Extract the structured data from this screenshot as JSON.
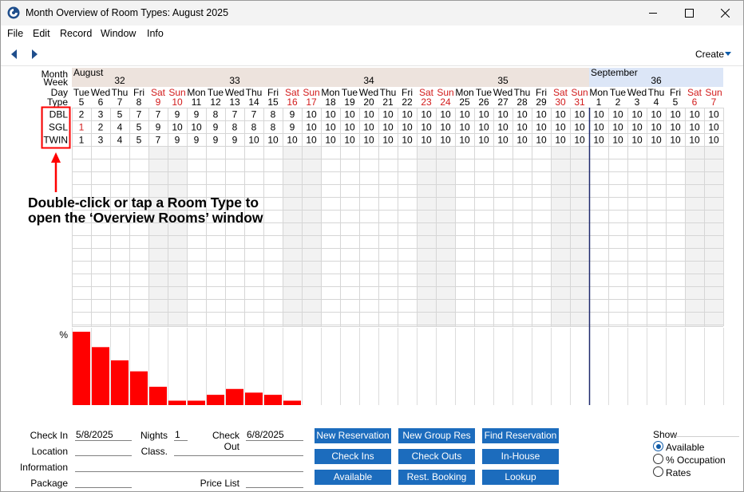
{
  "window": {
    "title": "Month Overview of Room Types: August 2025",
    "controls": {
      "minimize": "minimize",
      "maximize": "maximize",
      "close": "close"
    }
  },
  "menu": [
    "File",
    "Edit",
    "Record",
    "Window",
    "Info"
  ],
  "toolbar": {
    "create_label": "Create"
  },
  "grid": {
    "header_labels": {
      "month": "Month",
      "week": "Week",
      "day": "Day",
      "type": "Type"
    },
    "months": [
      {
        "name": "August",
        "bg": "#ede3dd"
      },
      {
        "name": "September",
        "bg": "#dce6f7"
      }
    ],
    "weeks": [
      {
        "label": "32",
        "start": 0,
        "span": 5
      },
      {
        "label": "33",
        "start": 5,
        "span": 7
      },
      {
        "label": "34",
        "start": 12,
        "span": 7
      },
      {
        "label": "35",
        "start": 19,
        "span": 7
      },
      {
        "label": "36",
        "start": 27,
        "span": 7
      }
    ],
    "days": [
      {
        "dow": "Tue",
        "date": "5",
        "weekend": false
      },
      {
        "dow": "Wed",
        "date": "6",
        "weekend": false
      },
      {
        "dow": "Thu",
        "date": "7",
        "weekend": false
      },
      {
        "dow": "Fri",
        "date": "8",
        "weekend": false
      },
      {
        "dow": "Sat",
        "date": "9",
        "weekend": true
      },
      {
        "dow": "Sun",
        "date": "10",
        "weekend": true
      },
      {
        "dow": "Mon",
        "date": "11",
        "weekend": false
      },
      {
        "dow": "Tue",
        "date": "12",
        "weekend": false
      },
      {
        "dow": "Wed",
        "date": "13",
        "weekend": false
      },
      {
        "dow": "Thu",
        "date": "14",
        "weekend": false
      },
      {
        "dow": "Fri",
        "date": "15",
        "weekend": false
      },
      {
        "dow": "Sat",
        "date": "16",
        "weekend": true
      },
      {
        "dow": "Sun",
        "date": "17",
        "weekend": true
      },
      {
        "dow": "Mon",
        "date": "18",
        "weekend": false
      },
      {
        "dow": "Tue",
        "date": "19",
        "weekend": false
      },
      {
        "dow": "Wed",
        "date": "20",
        "weekend": false
      },
      {
        "dow": "Thu",
        "date": "21",
        "weekend": false
      },
      {
        "dow": "Fri",
        "date": "22",
        "weekend": false
      },
      {
        "dow": "Sat",
        "date": "23",
        "weekend": true
      },
      {
        "dow": "Sun",
        "date": "24",
        "weekend": true
      },
      {
        "dow": "Mon",
        "date": "25",
        "weekend": false
      },
      {
        "dow": "Tue",
        "date": "26",
        "weekend": false
      },
      {
        "dow": "Wed",
        "date": "27",
        "weekend": false
      },
      {
        "dow": "Thu",
        "date": "28",
        "weekend": false
      },
      {
        "dow": "Fri",
        "date": "29",
        "weekend": false
      },
      {
        "dow": "Sat",
        "date": "30",
        "weekend": true
      },
      {
        "dow": "Sun",
        "date": "31",
        "weekend": true
      },
      {
        "dow": "Mon",
        "date": "1",
        "weekend": false
      },
      {
        "dow": "Tue",
        "date": "2",
        "weekend": false
      },
      {
        "dow": "Wed",
        "date": "3",
        "weekend": false
      },
      {
        "dow": "Thu",
        "date": "4",
        "weekend": false
      },
      {
        "dow": "Fri",
        "date": "5",
        "weekend": false
      },
      {
        "dow": "Sat",
        "date": "6",
        "weekend": true
      },
      {
        "dow": "Sun",
        "date": "7",
        "weekend": true
      }
    ],
    "room_types": [
      {
        "code": "DBL",
        "values": [
          "2",
          "3",
          "5",
          "7",
          "7",
          "9",
          "9",
          "8",
          "7",
          "7",
          "8",
          "9",
          "10",
          "10",
          "10",
          "10",
          "10",
          "10",
          "10",
          "10",
          "10",
          "10",
          "10",
          "10",
          "10",
          "10",
          "10",
          "10",
          "10",
          "10",
          "10",
          "10",
          "10",
          "10"
        ]
      },
      {
        "code": "SGL",
        "values": [
          "1",
          "2",
          "4",
          "5",
          "9",
          "10",
          "10",
          "9",
          "8",
          "8",
          "8",
          "9",
          "10",
          "10",
          "10",
          "10",
          "10",
          "10",
          "10",
          "10",
          "10",
          "10",
          "10",
          "10",
          "10",
          "10",
          "10",
          "10",
          "10",
          "10",
          "10",
          "10",
          "10",
          "10"
        ],
        "red_first": true
      },
      {
        "code": "TWIN",
        "values": [
          "1",
          "3",
          "4",
          "5",
          "7",
          "9",
          "9",
          "9",
          "9",
          "10",
          "10",
          "10",
          "10",
          "10",
          "10",
          "10",
          "10",
          "10",
          "10",
          "10",
          "10",
          "10",
          "10",
          "10",
          "10",
          "10",
          "10",
          "10",
          "10",
          "10",
          "10",
          "10",
          "10",
          "10"
        ]
      }
    ]
  },
  "chart_data": {
    "type": "bar",
    "ylabel": "%",
    "categories": [
      "5",
      "6",
      "7",
      "8",
      "9",
      "10",
      "11",
      "12",
      "13",
      "14",
      "15",
      "16"
    ],
    "values": [
      100,
      79,
      61,
      46,
      25,
      6,
      6,
      14,
      22,
      17,
      14,
      6
    ],
    "ylim": [
      0,
      100
    ],
    "color": "#ff0000"
  },
  "annotation": {
    "line1": "Double-click or tap a Room Type to",
    "line2": "open the ‘Overview Rooms’ window"
  },
  "form": {
    "check_in_label": "Check In",
    "check_in_value": "5/8/2025",
    "nights_label": "Nights",
    "nights_value": "1",
    "check_out_label": "Check Out",
    "check_out_value": "6/8/2025",
    "location_label": "Location",
    "class_label": "Class.",
    "information_label": "Information",
    "package_label": "Package",
    "price_list_label": "Price List"
  },
  "buttons": {
    "new_reservation": "New Reservation",
    "new_group_res": "New Group Res",
    "find_reservation": "Find Reservation",
    "check_ins": "Check Ins",
    "check_outs": "Check Outs",
    "in_house": "In-House",
    "available": "Available",
    "rest_booking": "Rest. Booking",
    "lookup": "Lookup"
  },
  "show": {
    "label": "Show",
    "options": [
      "Available",
      "% Occupation",
      "Rates"
    ],
    "selected": "Available"
  },
  "colors": {
    "accent": "#1c6cbd",
    "weekend_text": "#d21b1b",
    "weekend_shade": "#f2f2f2",
    "highlight_box": "#ff0000",
    "today_line": "#1f2a6e"
  }
}
